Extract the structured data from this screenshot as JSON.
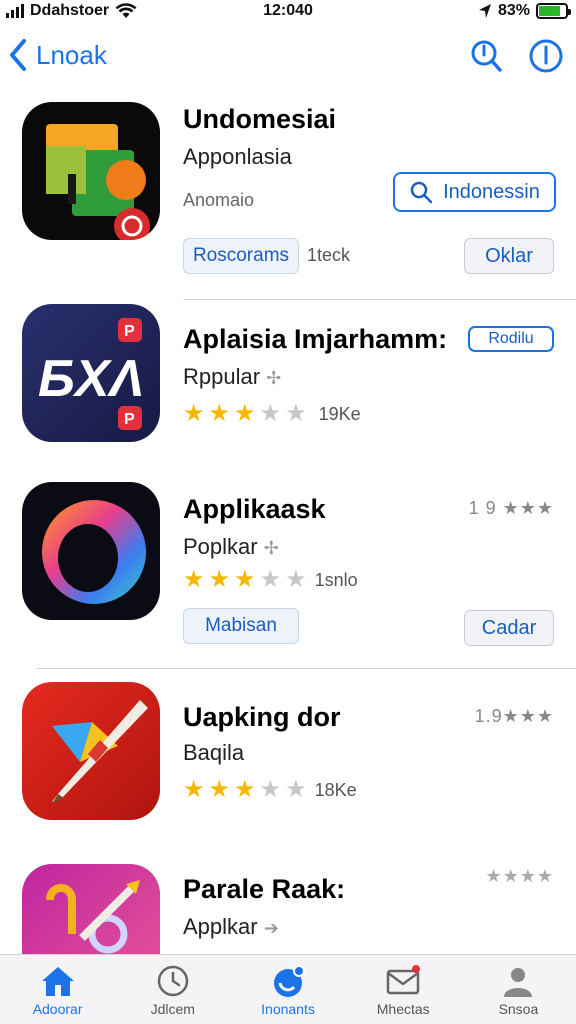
{
  "status": {
    "carrier": "Ddahstoer",
    "time": "12:040",
    "battery": "83%"
  },
  "nav": {
    "back_label": "Lnoak",
    "icons": [
      "search-icon",
      "info-icon"
    ]
  },
  "apps": [
    {
      "title": "Undomesiai",
      "subtitle": "Apponlasia",
      "meta": "Anomaio",
      "action_label": "Indonessin",
      "secondary_label": "Roscorams",
      "secondary_meta": "1teck",
      "get_label": "Oklar",
      "icon": "app-icon-orange-green"
    },
    {
      "title": "Aplaisia Imjarhamm:",
      "subtitle": "Rppular",
      "badge_label": "Rodilu",
      "rating_count": "19Ke",
      "stars": 3,
      "icon": "app-icon-bxa"
    },
    {
      "title": "Applikaask",
      "subtitle": "Poplkar",
      "rating_count": "1snlo",
      "rating_right": "1 9 ★★★",
      "stars": 3,
      "secondary_label": "Mabisan",
      "get_label": "Cadar",
      "icon": "app-icon-ring"
    },
    {
      "title": "Uapking dor",
      "subtitle": "Baqila",
      "rating_count": "18Ke",
      "rating_right": "1.9★★★",
      "stars": 3,
      "icon": "app-icon-brush"
    },
    {
      "title": "Parale Raak:",
      "subtitle": "Applkar",
      "rating_right": "★★★★",
      "icon": "app-icon-pencil"
    }
  ],
  "tabs": [
    {
      "label": "Adoorar",
      "icon": "home-icon",
      "active": true
    },
    {
      "label": "Jdlcem",
      "icon": "clock-icon",
      "active": false
    },
    {
      "label": "Inonants",
      "icon": "updates-icon",
      "active": true
    },
    {
      "label": "Mhectas",
      "icon": "mail-icon",
      "active": false
    },
    {
      "label": "Snsoa",
      "icon": "person-icon",
      "active": false
    }
  ],
  "colors": {
    "accent": "#1a73e8",
    "star": "#f5b800",
    "battery": "#2bb52b"
  }
}
